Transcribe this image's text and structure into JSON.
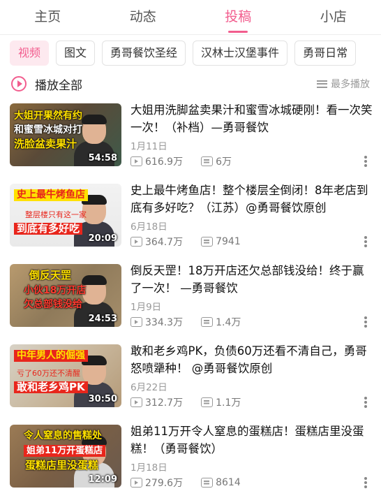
{
  "tabs": [
    "主页",
    "动态",
    "投稿",
    "小店"
  ],
  "chips": [
    "视频",
    "图文",
    "勇哥餐饮圣经",
    "汉林士汉堡事件",
    "勇哥日常"
  ],
  "play_all": "播放全部",
  "sort_label": "最多播放",
  "colors": {
    "accent": "#f25d8e",
    "chip_active_bg": "#fde9ef"
  },
  "icons": {
    "play_all": "play-circle-icon",
    "sort": "list-sort-icon",
    "views": "play-count-icon",
    "danmaku": "danmaku-icon",
    "more": "more-vertical-icon"
  },
  "videos": [
    {
      "title": "大姐用洗脚盆卖果汁和蜜雪冰城硬刚！看一次笑一次！（补档）—勇哥餐饮",
      "date": "1月11日",
      "views": "616.9万",
      "danmaku": "6万",
      "duration": "54:58",
      "thumb_text": [
        "大姐开果然有约",
        "和蜜雪冰城对打",
        "洗脸盆卖果汁"
      ]
    },
    {
      "title": "史上最牛烤鱼店！整个楼层全倒闭！8年老店到底有多好吃？（江苏）@勇哥餐饮原创",
      "date": "6月18日",
      "views": "364.7万",
      "danmaku": "7941",
      "duration": "20:09",
      "thumb_text": [
        "史上最牛烤鱼店",
        "整层楼只有这一家",
        "到底有多好吃"
      ]
    },
    {
      "title": "倒反天罡！18万开店还欠总部钱没给！终于赢了一次！ —勇哥餐饮",
      "date": "1月9日",
      "views": "334.3万",
      "danmaku": "1.4万",
      "duration": "24:53",
      "thumb_text": [
        "倒反天罡",
        "小伙18万开店",
        "欠总部钱没给"
      ]
    },
    {
      "title": "敢和老乡鸡PK，负债60万还看不清自己，勇哥怒喷犟种！ @勇哥餐饮原创",
      "date": "6月22日",
      "views": "312.7万",
      "danmaku": "1.1万",
      "duration": "30:50",
      "thumb_text": [
        "中年男人的倔强",
        "亏了60万还不清醒",
        "敢和老乡鸡PK"
      ]
    },
    {
      "title": "姐弟11万开令人窒息的蛋糕店！蛋糕店里没蛋糕！（勇哥餐饮）",
      "date": "1月18日",
      "views": "279.6万",
      "danmaku": "8614",
      "duration": "12:09",
      "thumb_text": [
        "令人窒息的售糕处",
        "姐弟11万开蛋糕店",
        "蛋糕店里没蛋糕"
      ]
    }
  ]
}
